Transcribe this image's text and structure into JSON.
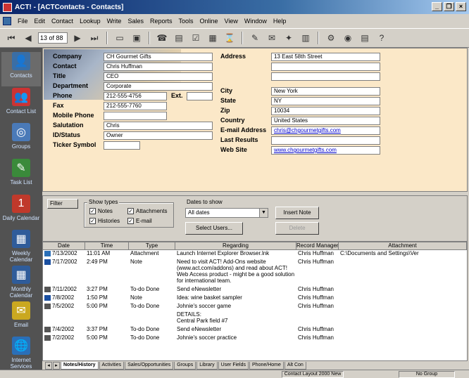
{
  "window": {
    "title": "ACT! - [ACTContacts - Contacts]"
  },
  "menu": [
    "File",
    "Edit",
    "Contact",
    "Lookup",
    "Write",
    "Sales",
    "Reports",
    "Tools",
    "Online",
    "View",
    "Window",
    "Help"
  ],
  "toolbar": {
    "record_counter": "13 of 88"
  },
  "nav": [
    {
      "label": "Contacts",
      "icon": "contacts-icon",
      "glyph": "👤"
    },
    {
      "label": "Contact List",
      "icon": "contact-list-icon",
      "glyph": "👥"
    },
    {
      "label": "Groups",
      "icon": "groups-icon",
      "glyph": "◎"
    },
    {
      "label": "Task List",
      "icon": "task-list-icon",
      "glyph": "✎"
    },
    {
      "label": "Daily Calendar",
      "icon": "daily-calendar-icon",
      "glyph": "1"
    },
    {
      "label": "Weekly Calendar",
      "icon": "weekly-calendar-icon",
      "glyph": "▦"
    },
    {
      "label": "Monthly Calendar",
      "icon": "monthly-calendar-icon",
      "glyph": "▦"
    },
    {
      "label": "Email",
      "icon": "email-icon",
      "glyph": "✉"
    },
    {
      "label": "Internet Services",
      "icon": "internet-icon",
      "glyph": "🌐"
    }
  ],
  "contact": {
    "company": {
      "label": "Company",
      "value": "CH Gourmet Gifts"
    },
    "contact": {
      "label": "Contact",
      "value": "Chris Huffman"
    },
    "title": {
      "label": "Title",
      "value": "CEO"
    },
    "department": {
      "label": "Department",
      "value": "Corporate"
    },
    "phone": {
      "label": "Phone",
      "value": "212-555-4756",
      "ext_label": "Ext.",
      "ext_value": ""
    },
    "fax": {
      "label": "Fax",
      "value": "212-555-7760"
    },
    "mobile": {
      "label": "Mobile Phone",
      "value": ""
    },
    "salutation": {
      "label": "Salutation",
      "value": "Chris"
    },
    "id_status": {
      "label": "ID/Status",
      "value": "Owner"
    },
    "ticker": {
      "label": "Ticker Symbol",
      "value": ""
    },
    "address": {
      "label": "Address",
      "line1": "13 East 58th Street",
      "line2": "",
      "line3": ""
    },
    "city": {
      "label": "City",
      "value": "New York"
    },
    "state": {
      "label": "State",
      "value": "NY"
    },
    "zip": {
      "label": "Zip",
      "value": "10034"
    },
    "country": {
      "label": "Country",
      "value": "United States"
    },
    "email": {
      "label": "E-mail Address",
      "value": "chris@chgourmetgifts.com"
    },
    "last_results": {
      "label": "Last Results",
      "value": ""
    },
    "web_site": {
      "label": "Web Site",
      "value": "www.chgourmetgifts.com"
    }
  },
  "filter": {
    "filter_label": "Filter",
    "show_types_label": "Show types",
    "notes": "Notes",
    "attachments": "Attachments",
    "histories": "Histories",
    "email": "E-mail",
    "dates_label": "Dates to show",
    "dates_value": "All dates",
    "select_users": "Select Users...",
    "insert_note": "Insert Note",
    "delete": "Delete"
  },
  "table": {
    "headers": [
      "Date",
      "Time",
      "Type",
      "Regarding",
      "Record Manager",
      "Attachment"
    ],
    "rows": [
      {
        "date": "7/13/2002",
        "time": "11:01 AM",
        "type": "Attachment",
        "regarding": "Launch Internet Explorer Browser.lnk",
        "manager": "Chris Huffman",
        "attachment": "C:\\Documents and Settings\\Ver",
        "icon": "attachment-icon"
      },
      {
        "date": "7/17/2002",
        "time": "2:49 PM",
        "type": "Note",
        "regarding": "Need to visit ACT! Add-Ons website (www.act.com/addons) and read about ACT! Web Access product - might be a good solution for international team.",
        "manager": "Chris Huffman",
        "attachment": "",
        "icon": "note-icon"
      },
      {
        "date": "7/11/2002",
        "time": "3:27 PM",
        "type": "To-do Done",
        "regarding": "Send eNewsletter",
        "manager": "Chris Huffman",
        "attachment": "",
        "icon": "todo-icon"
      },
      {
        "date": "7/8/2002",
        "time": "1:50 PM",
        "type": "Note",
        "regarding": "Idea: wine basket sampler",
        "manager": "Chris Huffman",
        "attachment": "",
        "icon": "note-icon"
      },
      {
        "date": "7/5/2002",
        "time": "5:00 PM",
        "type": "To-do Done",
        "regarding": "Johnie's soccer game",
        "manager": "Chris Huffman",
        "attachment": "",
        "icon": "todo-icon"
      },
      {
        "date": "",
        "time": "",
        "type": "",
        "regarding": "DETAILS:\nCentral Park field #7",
        "manager": "",
        "attachment": "",
        "icon": ""
      },
      {
        "date": "7/4/2002",
        "time": "3:37 PM",
        "type": "To-do Done",
        "regarding": "Send eNewsletter",
        "manager": "Chris Huffman",
        "attachment": "",
        "icon": "todo-icon"
      },
      {
        "date": "7/2/2002",
        "time": "5:00 PM",
        "type": "To-do Done",
        "regarding": "Johnie's soccer practice",
        "manager": "Chris Huffman",
        "attachment": "",
        "icon": "todo-icon"
      }
    ]
  },
  "tabs": [
    "Notes/History",
    "Activities",
    "Sales/Opportunities",
    "Groups",
    "Library",
    "User Fields",
    "Phone/Home",
    "Alt Con"
  ],
  "status": {
    "layout": "Contact Layout 2000 New",
    "group": "No Group"
  }
}
